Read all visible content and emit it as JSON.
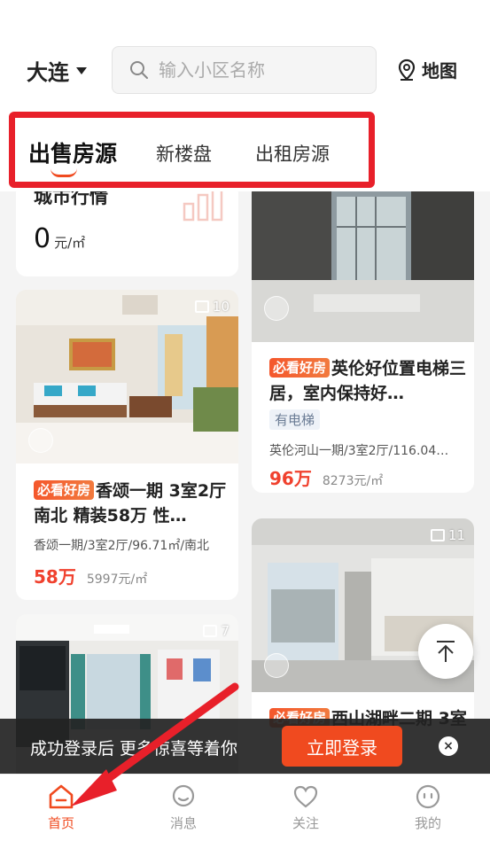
{
  "header": {
    "city": "大连",
    "search_placeholder": "输入小区名称",
    "map_label": "地图"
  },
  "tabs": [
    {
      "label": "出售房源",
      "active": true
    },
    {
      "label": "新楼盘",
      "active": false
    },
    {
      "label": "出租房源",
      "active": false
    }
  ],
  "market": {
    "title": "城市行情",
    "price_value": "0",
    "price_unit": "元/㎡"
  },
  "listings": [
    {
      "image_count": "10",
      "badge": "必看好房",
      "title": "香颂一期 3室2厅 南北 精装58万 性…",
      "tag": "",
      "meta": "香颂一期/3室2厅/96.71㎡/南北",
      "total": "58万",
      "unit_price": "5997元/㎡"
    },
    {
      "image_count": "",
      "badge": "必看好房",
      "title": "英伦好位置电梯三居，室内保持好…",
      "tag": "有电梯",
      "meta": "英伦河山一期/3室2厅/116.04…",
      "total": "96万",
      "unit_price": "8273元/㎡"
    },
    {
      "image_count": "7"
    },
    {
      "image_count": "11",
      "badge": "必看好房",
      "title": "西山湖畔二期 3室"
    }
  ],
  "login_banner": {
    "text": "成功登录后 更多惊喜等着你",
    "button": "立即登录"
  },
  "bottom_nav": [
    {
      "label": "首页",
      "icon": "home-icon",
      "active": true
    },
    {
      "label": "消息",
      "icon": "message-icon",
      "active": false
    },
    {
      "label": "关注",
      "icon": "heart-icon",
      "active": false
    },
    {
      "label": "我的",
      "icon": "profile-icon",
      "active": false
    }
  ],
  "colors": {
    "accent": "#f04a1f",
    "price_red": "#f0412e",
    "highlight_red": "#e8202a"
  }
}
